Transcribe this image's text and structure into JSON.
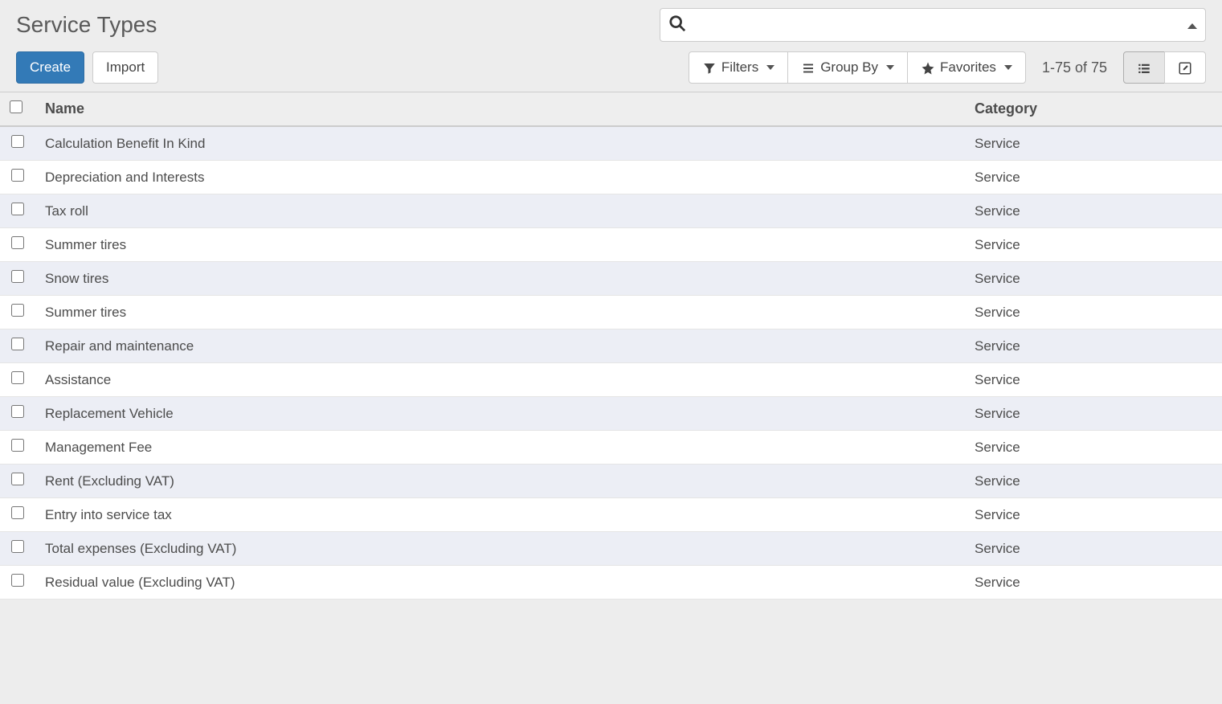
{
  "header": {
    "title": "Service Types",
    "create_label": "Create",
    "import_label": "Import"
  },
  "search": {
    "placeholder": ""
  },
  "toolbar": {
    "filters_label": "Filters",
    "group_by_label": "Group By",
    "favorites_label": "Favorites"
  },
  "pager": {
    "text": "1-75 of 75"
  },
  "columns": {
    "name": "Name",
    "category": "Category"
  },
  "rows": [
    {
      "name": "Calculation Benefit In Kind",
      "category": "Service"
    },
    {
      "name": "Depreciation and Interests",
      "category": "Service"
    },
    {
      "name": "Tax roll",
      "category": "Service"
    },
    {
      "name": "Summer tires",
      "category": "Service"
    },
    {
      "name": "Snow tires",
      "category": "Service"
    },
    {
      "name": "Summer tires",
      "category": "Service"
    },
    {
      "name": "Repair and maintenance",
      "category": "Service"
    },
    {
      "name": "Assistance",
      "category": "Service"
    },
    {
      "name": "Replacement Vehicle",
      "category": "Service"
    },
    {
      "name": "Management Fee",
      "category": "Service"
    },
    {
      "name": "Rent (Excluding VAT)",
      "category": "Service"
    },
    {
      "name": "Entry into service tax",
      "category": "Service"
    },
    {
      "name": "Total expenses (Excluding VAT)",
      "category": "Service"
    },
    {
      "name": "Residual value (Excluding VAT)",
      "category": "Service"
    }
  ]
}
